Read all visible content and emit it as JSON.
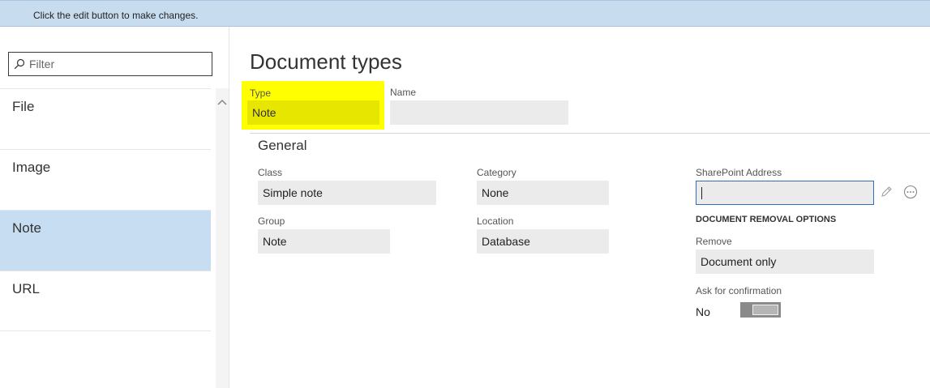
{
  "infobar": {
    "message": "Click the edit button to make changes."
  },
  "filter": {
    "placeholder": "Filter"
  },
  "list": {
    "items": [
      {
        "label": "File",
        "selected": false
      },
      {
        "label": "Image",
        "selected": false
      },
      {
        "label": "Note",
        "selected": true
      },
      {
        "label": "URL",
        "selected": false
      }
    ]
  },
  "page": {
    "title": "Document types"
  },
  "header_fields": {
    "type_label": "Type",
    "type_value": "Note",
    "name_label": "Name",
    "name_value": ""
  },
  "general": {
    "section_title": "General",
    "class_label": "Class",
    "class_value": "Simple note",
    "group_label": "Group",
    "group_value": "Note",
    "category_label": "Category",
    "category_value": "None",
    "location_label": "Location",
    "location_value": "Database",
    "sharepoint_label": "SharePoint Address",
    "sharepoint_value": "",
    "removal_heading": "DOCUMENT REMOVAL OPTIONS",
    "remove_label": "Remove",
    "remove_value": "Document only",
    "confirm_label": "Ask for confirmation",
    "confirm_value": "No"
  },
  "icons": {
    "filter": "search-icon",
    "scroll_up": "chevron-up-icon",
    "edit": "pencil-icon",
    "more": "more-icon"
  },
  "colors": {
    "infobar": "#c8dcf0",
    "selected_row": "#c7ddf2",
    "highlight": "#ffff00",
    "field_bg": "#ebebeb",
    "focus_border": "#2f6fb6"
  }
}
